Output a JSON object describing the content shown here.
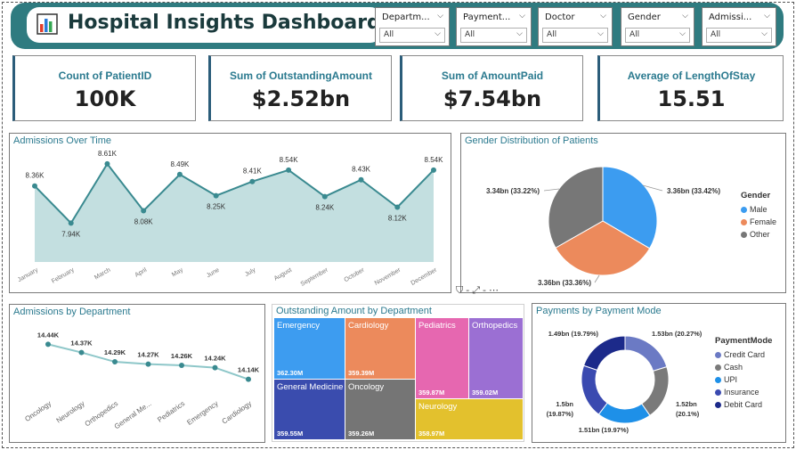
{
  "header": {
    "title": "Hospital Insights Dashboard",
    "logo_icon": "bar-chart-icon"
  },
  "slicers": [
    {
      "title": "Departm...",
      "value": "All"
    },
    {
      "title": "Payment...",
      "value": "All"
    },
    {
      "title": "Doctor",
      "value": "All"
    },
    {
      "title": "Gender",
      "value": "All"
    },
    {
      "title": "Admissi...",
      "value": "All"
    }
  ],
  "kpis": [
    {
      "label": "Count of PatientID",
      "value": "100K"
    },
    {
      "label": "Sum of OutstandingAmount",
      "value": "$2.52bn"
    },
    {
      "label": "Sum of AmountPaid",
      "value": "$7.54bn"
    },
    {
      "label": "Average of LengthOfStay",
      "value": "15.51"
    }
  ],
  "panels": {
    "admissions_time": {
      "title": "Admissions Over Time"
    },
    "gender": {
      "title": "Gender Distribution of Patients"
    },
    "admissions_dept": {
      "title": "Admissions by Department"
    },
    "outstanding": {
      "title": "Outstanding Amount by Department"
    },
    "payments": {
      "title": "Payments by Payment Mode"
    }
  },
  "colors": {
    "teal": "#2f7b80",
    "line": "#3a8a90",
    "area": "#c3dfe0",
    "male": "#3c9cf0",
    "female": "#ec8a5c",
    "other": "#777777"
  },
  "chart_data": [
    {
      "type": "area",
      "title": "Admissions Over Time",
      "categories": [
        "January",
        "February",
        "March",
        "April",
        "May",
        "June",
        "July",
        "August",
        "September",
        "October",
        "November",
        "December"
      ],
      "values": [
        8360,
        7940,
        8610,
        8080,
        8490,
        8250,
        8410,
        8540,
        8240,
        8430,
        8120,
        8540
      ],
      "labels": [
        "8.36K",
        "7.94K",
        "8.61K",
        "8.08K",
        "8.49K",
        "8.25K",
        "8.41K",
        "8.54K",
        "8.24K",
        "8.43K",
        "8.12K",
        "8.54K"
      ],
      "ylim": [
        7500,
        8750
      ]
    },
    {
      "type": "pie",
      "title": "Gender Distribution of Patients",
      "legend_title": "Gender",
      "slices": [
        {
          "name": "Male",
          "value": 33.42,
          "label": "3.36bn (33.42%)",
          "color": "#3c9cf0"
        },
        {
          "name": "Female",
          "value": 33.36,
          "label": "3.36bn (33.36%)",
          "color": "#ec8a5c"
        },
        {
          "name": "Other",
          "value": 33.22,
          "label": "3.34bn (33.22%)",
          "color": "#777777"
        }
      ]
    },
    {
      "type": "line",
      "title": "Admissions by Department",
      "categories": [
        "Oncology",
        "Neurology",
        "Orthopedics",
        "General Me...",
        "Pediatrics",
        "Emergency",
        "Cardiology"
      ],
      "values": [
        14440,
        14370,
        14290,
        14270,
        14260,
        14240,
        14140
      ],
      "labels": [
        "14.44K",
        "14.37K",
        "14.29K",
        "14.27K",
        "14.26K",
        "14.24K",
        "14.14K"
      ],
      "ylim": [
        14000,
        14550
      ]
    },
    {
      "type": "treemap",
      "title": "Outstanding Amount by Department",
      "items": [
        {
          "name": "Emergency",
          "label": "362.30M",
          "color": "#3d9cf0"
        },
        {
          "name": "Cardiology",
          "label": "359.39M",
          "color": "#ec8a5c"
        },
        {
          "name": "Pediatrics",
          "label": "359.87M",
          "color": "#e667b0"
        },
        {
          "name": "Orthopedics",
          "label": "359.02M",
          "color": "#9b6fd3"
        },
        {
          "name": "General Medicine",
          "label": "359.55M",
          "color": "#3a4cae"
        },
        {
          "name": "Oncology",
          "label": "359.26M",
          "color": "#757575"
        },
        {
          "name": "Neurology",
          "label": "358.97M",
          "color": "#e3c12d"
        }
      ]
    },
    {
      "type": "pie",
      "title": "Payments by Payment Mode",
      "legend_title": "PaymentMode",
      "slices": [
        {
          "name": "Credit Card",
          "value": 20.27,
          "label": "1.53bn (20.27%)",
          "color": "#6b7ac4"
        },
        {
          "name": "Cash",
          "value": 20.1,
          "label": "1.52bn (20.1%)",
          "color": "#7a7a7a"
        },
        {
          "name": "UPI",
          "value": 19.97,
          "label": "1.51bn (19.97%)",
          "color": "#1e90e8"
        },
        {
          "name": "Insurance",
          "value": 19.87,
          "label": "1.5bn (19.87%)",
          "color": "#3a4ab0"
        },
        {
          "name": "Debit Card",
          "value": 19.79,
          "label": "1.49bn (19.79%)",
          "color": "#1c2a8a"
        }
      ]
    }
  ]
}
